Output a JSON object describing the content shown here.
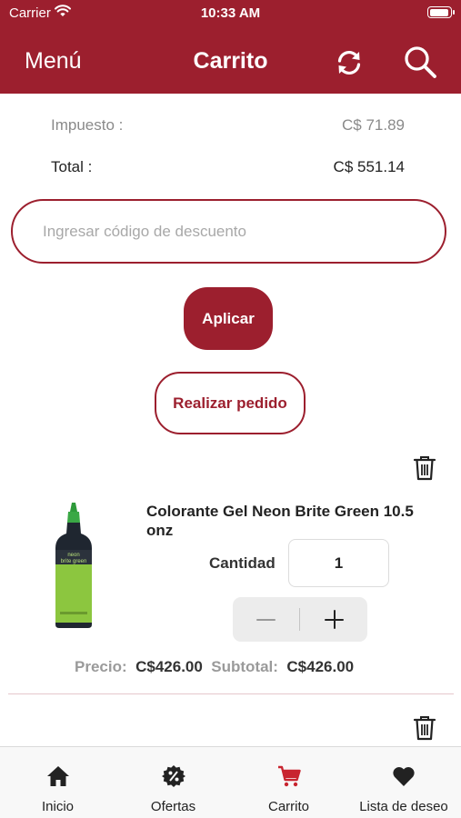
{
  "status_bar": {
    "carrier": "Carrier",
    "time": "10:33 AM"
  },
  "nav": {
    "menu_label": "Menú",
    "title": "Carrito"
  },
  "summary": {
    "tax_label": "Impuesto :",
    "tax_value": "C$ 71.89",
    "total_label": "Total :",
    "total_value": "C$ 551.14"
  },
  "discount": {
    "placeholder": "Ingresar código de descuento"
  },
  "buttons": {
    "apply": "Aplicar",
    "place_order": "Realizar pedido"
  },
  "product": {
    "name": "Colorante Gel Neon Brite Green 10.5 onz",
    "quantity_label": "Cantidad",
    "quantity": "1",
    "price_label": "Precio:",
    "price": "C$426.00",
    "subtotal_label": "Subtotal:",
    "subtotal": "C$426.00",
    "bottle_label": "neon brite green"
  },
  "tabs": [
    {
      "label": "Inicio",
      "icon": "home-icon"
    },
    {
      "label": "Ofertas",
      "icon": "discount-icon"
    },
    {
      "label": "Carrito",
      "icon": "cart-icon",
      "active": true
    },
    {
      "label": "Lista de deseo",
      "icon": "heart-icon"
    }
  ],
  "colors": {
    "brand": "#9c1f2e",
    "cart_active": "#c8242f",
    "bottle_green": "#8cc63f"
  }
}
